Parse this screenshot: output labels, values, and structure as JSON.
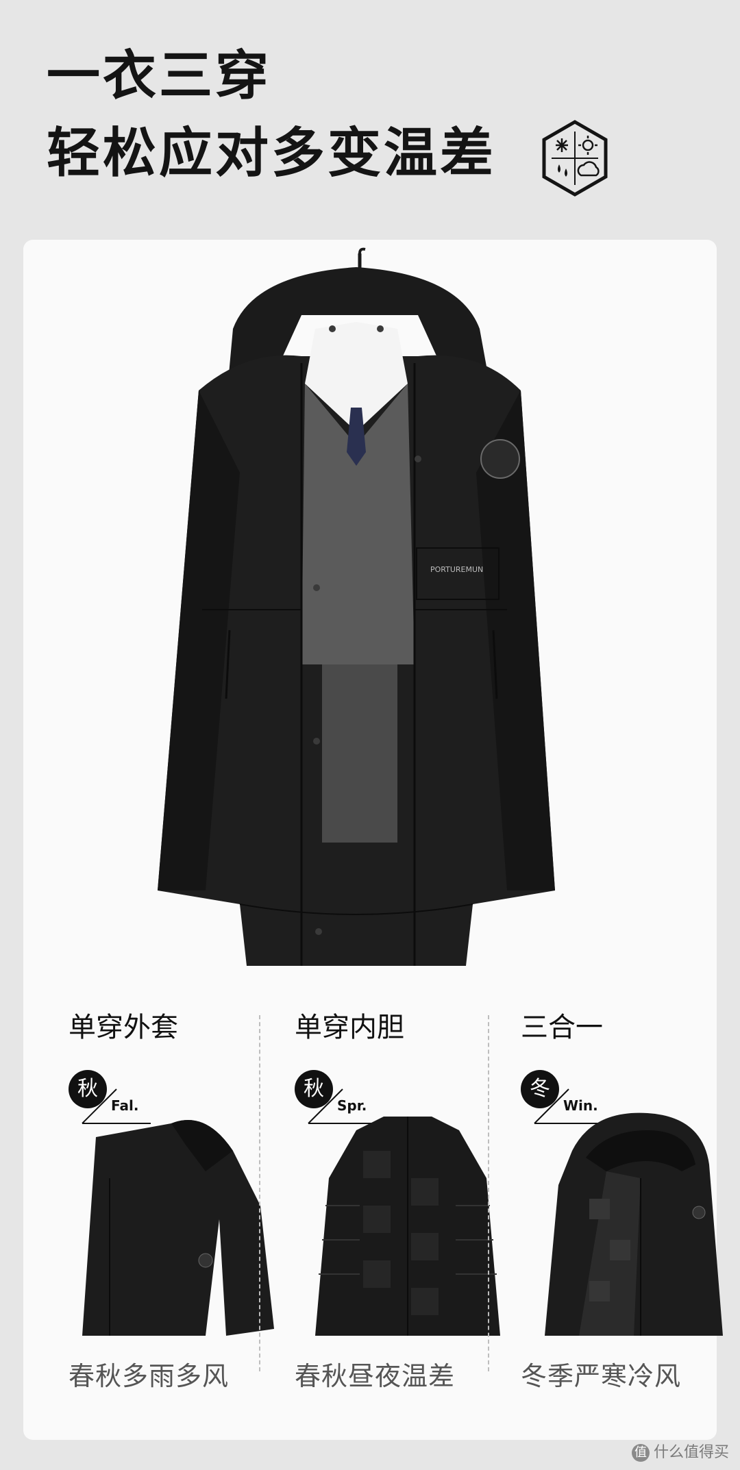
{
  "headline": {
    "line1": "一衣三穿",
    "line2": "轻松应对多变温差"
  },
  "hero": {
    "brand_label": "PORTUREMUN"
  },
  "columns": [
    {
      "title": "单穿外套",
      "season_char": "秋",
      "season_en": "Fal.",
      "caption": "春秋多雨多风"
    },
    {
      "title": "单穿内胆",
      "season_char": "秋",
      "season_en": "Spr.",
      "caption": "春秋昼夜温差"
    },
    {
      "title": "三合一",
      "season_char": "冬",
      "season_en": "Win.",
      "caption": "冬季严寒冷风"
    }
  ],
  "watermark": {
    "badge": "值",
    "text": "什么值得买"
  },
  "colors": {
    "background": "#e6e6e6",
    "card": "#fafafa",
    "ink": "#141414",
    "caption": "#555555"
  }
}
